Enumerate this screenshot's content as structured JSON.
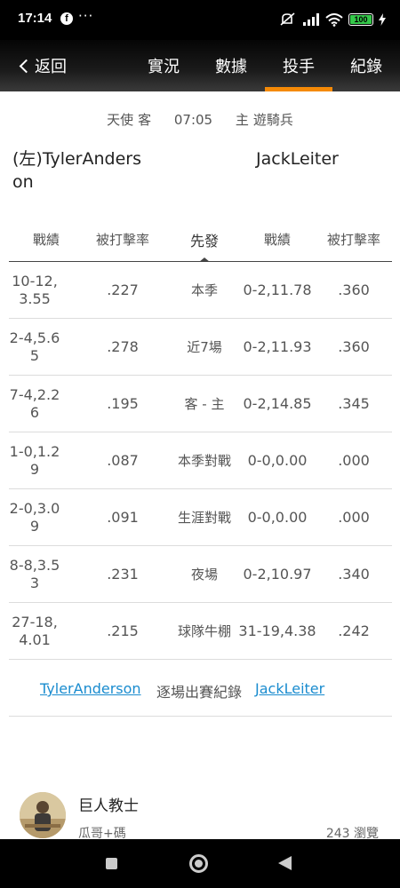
{
  "status_bar": {
    "time": "17:14",
    "battery": "100"
  },
  "nav": {
    "back_label": "返回",
    "tabs": [
      "實況",
      "數據",
      "投手",
      "紀錄"
    ],
    "active_tab": "投手",
    "accent_color": "#f58a07"
  },
  "matchup": {
    "away_team": "天使",
    "away_tag": "客",
    "time": "07:05",
    "home_tag": "主",
    "home_team": "遊騎兵",
    "left_pitcher": "(左)TylerAnderson",
    "right_pitcher": "JackLeiter"
  },
  "table": {
    "headers": [
      "戰績",
      "被打擊率",
      "先發",
      "戰績",
      "被打擊率"
    ],
    "rows": [
      {
        "l_rec": "10-12,3.55",
        "l_avg": ".227",
        "label": "本季",
        "r_rec": "0-2,11.78",
        "r_avg": ".360"
      },
      {
        "l_rec": "2-4,5.65",
        "l_avg": ".278",
        "label": "近7場",
        "r_rec": "0-2,11.93",
        "r_avg": ".360"
      },
      {
        "l_rec": "7-4,2.26",
        "l_avg": ".195",
        "label": "客 - 主",
        "r_rec": "0-2,14.85",
        "r_avg": ".345"
      },
      {
        "l_rec": "1-0,1.29",
        "l_avg": ".087",
        "label": "本季對戰",
        "r_rec": "0-0,0.00",
        "r_avg": ".000"
      },
      {
        "l_rec": "2-0,3.09",
        "l_avg": ".091",
        "label": "生涯對戰",
        "r_rec": "0-0,0.00",
        "r_avg": ".000"
      },
      {
        "l_rec": "8-8,3.53",
        "l_avg": ".231",
        "label": "夜場",
        "r_rec": "0-2,10.97",
        "r_avg": ".340"
      },
      {
        "l_rec": "27-18,4.01",
        "l_avg": ".215",
        "label": "球隊牛棚",
        "r_rec": "31-19,4.38",
        "r_avg": ".242"
      }
    ]
  },
  "game_log": {
    "left_link": "TylerAnderson",
    "middle_text": "逐場出賽紀錄",
    "right_link": "JackLeiter",
    "link_color": "#1a8ccf"
  },
  "author": {
    "name": "巨人教士",
    "subtitle": "瓜哥+碼",
    "views": "243 瀏覽"
  }
}
